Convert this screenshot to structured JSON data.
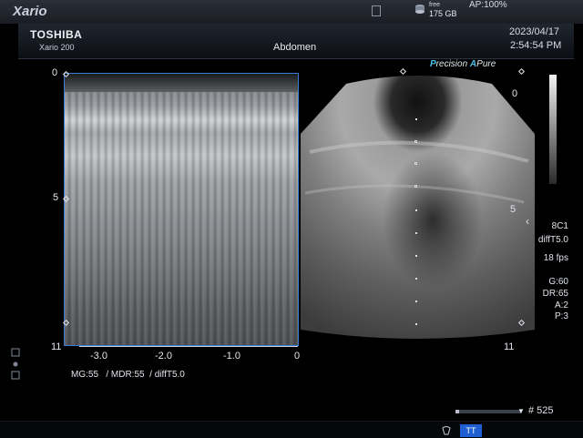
{
  "topbar": {
    "brand": "Xario",
    "free_label": "free",
    "free_value": "175 GB",
    "ap_status": "AP:100%"
  },
  "header": {
    "maker": "TOSHIBA",
    "model": "Xario 200",
    "exam": "Abdomen",
    "date": "2023/04/17",
    "time": "2:54:54 PM"
  },
  "image_info": {
    "precision_p": "P",
    "precision_rest": "recision",
    "apure_a": "A",
    "apure_rest": "Pure"
  },
  "mmode": {
    "depth_top": "0",
    "depth_mid": "5",
    "depth_bottom": "11",
    "time_ticks": [
      "-3.0",
      "-2.0",
      "-1.0",
      "0"
    ],
    "footer": "MG:55   / MDR:55  / diffT5.0"
  },
  "bmode": {
    "depth_top": "0",
    "depth_mid": "5",
    "depth_bottom": "11"
  },
  "params": {
    "probe": "8C1",
    "mode": "diffT5.0",
    "fps": "18 fps",
    "gain": "G:60",
    "dr": "DR:65",
    "a": "A:2",
    "p": "P:3"
  },
  "cine": {
    "frame": "# 525"
  },
  "bottom": {
    "tt_label": "TT"
  },
  "colors": {
    "accent_blue": "#3a7bd5",
    "precision_cyan": "#49c3e8",
    "tt_button": "#1f5fd1"
  }
}
